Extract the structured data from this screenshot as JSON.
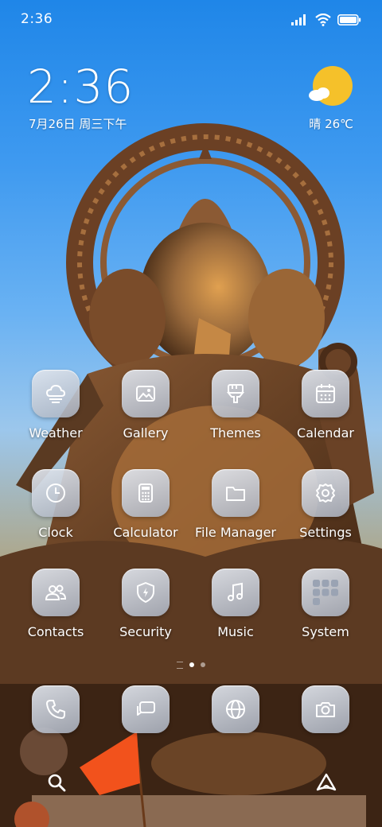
{
  "status_bar": {
    "time": "2:36"
  },
  "clock_widget": {
    "time": "2:36",
    "date": "7月26日 周三下午"
  },
  "weather_widget": {
    "text": "晴 26℃"
  },
  "apps": [
    {
      "label": "Weather",
      "icon": "weather-cloud-icon"
    },
    {
      "label": "Gallery",
      "icon": "gallery-icon"
    },
    {
      "label": "Themes",
      "icon": "themes-brush-icon"
    },
    {
      "label": "Calendar",
      "icon": "calendar-icon"
    },
    {
      "label": "Clock",
      "icon": "clock-icon"
    },
    {
      "label": "Calculator",
      "icon": "calculator-icon"
    },
    {
      "label": "File Manager",
      "icon": "folder-icon"
    },
    {
      "label": "Settings",
      "icon": "gear-icon"
    },
    {
      "label": "Contacts",
      "icon": "contacts-icon"
    },
    {
      "label": "Security",
      "icon": "shield-icon"
    },
    {
      "label": "Music",
      "icon": "music-note-icon"
    },
    {
      "label": "System",
      "icon": "system-folder-icon"
    }
  ],
  "dock": [
    {
      "icon": "phone-icon"
    },
    {
      "icon": "messages-icon"
    },
    {
      "icon": "browser-globe-icon"
    },
    {
      "icon": "camera-icon"
    }
  ],
  "colors": {
    "sky_top": "#1f86e8",
    "statue": "#7a5230",
    "sun": "#f5c12a"
  }
}
